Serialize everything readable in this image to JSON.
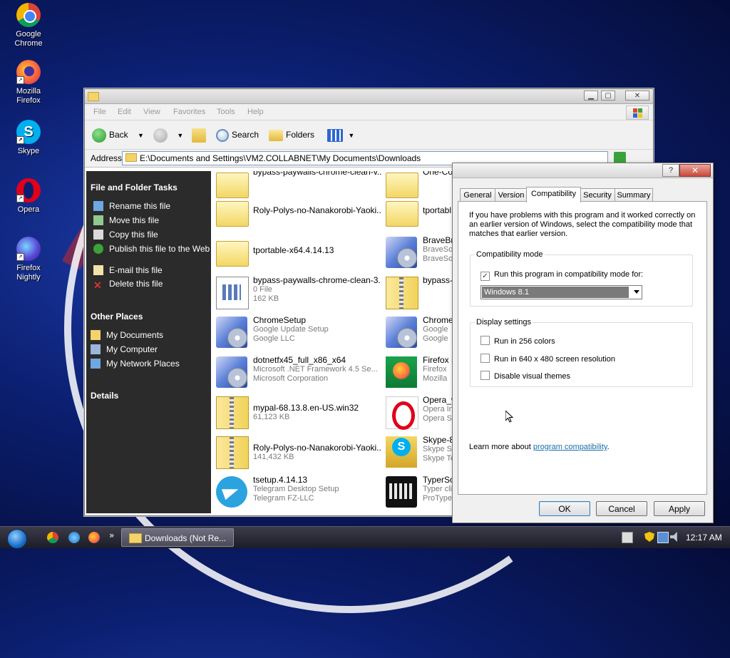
{
  "desktop": {
    "icons": [
      {
        "label": "Google Chrome",
        "icon": "chrome-icon"
      },
      {
        "label": "Mozilla Firefox",
        "icon": "firefox-icon"
      },
      {
        "label": "Skype",
        "icon": "skype-icon"
      },
      {
        "label": "Opera",
        "icon": "opera-icon"
      },
      {
        "label": "Firefox Nightly",
        "icon": "firefox-nightly-icon"
      }
    ]
  },
  "explorer": {
    "menu": [
      "File",
      "Edit",
      "View",
      "Favorites",
      "Tools",
      "Help"
    ],
    "toolbar": {
      "back": "Back",
      "search": "Search",
      "folders": "Folders"
    },
    "address_label": "Address",
    "address": "E:\\Documents and Settings\\VM2.COLLABNET\\My Documents\\Downloads",
    "tasks_title": "File and Folder Tasks",
    "tasks": [
      "Rename this file",
      "Move this file",
      "Copy this file",
      "Publish this file to the Web",
      "E-mail this file",
      "Delete this file"
    ],
    "other_title": "Other Places",
    "other": [
      "My Documents",
      "My Computer",
      "My Network Places"
    ],
    "details_title": "Details",
    "files_left": [
      {
        "name": "bypass-paywalls-chrome-clean-v...",
        "line2": "",
        "line3": "",
        "icon": "folder"
      },
      {
        "name": "Roly-Polys-no-Nanakorobi-Yaoki...",
        "line2": "",
        "line3": "",
        "icon": "folder"
      },
      {
        "name": "tportable-x64.4.14.13",
        "line2": "",
        "line3": "",
        "icon": "folder"
      },
      {
        "name": "bypass-paywalls-chrome-clean-3....",
        "line2": "0 File",
        "line3": "162 KB",
        "icon": "document"
      },
      {
        "name": "ChromeSetup",
        "line2": "Google Update Setup",
        "line3": "Google LLC",
        "icon": "setup"
      },
      {
        "name": "dotnetfx45_full_x86_x64",
        "line2": "Microsoft .NET Framework 4.5 Se...",
        "line3": "Microsoft Corporation",
        "icon": "dotnet"
      },
      {
        "name": "mypal-68.13.8.en-US.win32",
        "line2": "61,123 KB",
        "line3": "",
        "icon": "zip"
      },
      {
        "name": "Roly-Polys-no-Nanakorobi-Yaoki...",
        "line2": "141,432 KB",
        "line3": "",
        "icon": "zip"
      },
      {
        "name": "tsetup.4.14.13",
        "line2": "Telegram Desktop Setup",
        "line3": "Telegram FZ-LLC",
        "icon": "telegram"
      }
    ],
    "files_right": [
      {
        "name": "One-Co",
        "line2": "",
        "line3": "",
        "icon": "folder"
      },
      {
        "name": "tportabl",
        "line2": "",
        "line3": "",
        "icon": "folder"
      },
      {
        "name": "BraveBro",
        "line2": "BraveSo",
        "line3": "BraveSo",
        "icon": "setup"
      },
      {
        "name": "bypass-",
        "line2": "",
        "line3": "",
        "icon": "zip"
      },
      {
        "name": "Chrome",
        "line2": "Google",
        "line3": "Google",
        "icon": "setup"
      },
      {
        "name": "Firefox S",
        "line2": "Firefox",
        "line3": "Mozilla",
        "icon": "firefox-setup"
      },
      {
        "name": "Opera_w",
        "line2": "Opera In",
        "line3": "Opera S",
        "icon": "opera"
      },
      {
        "name": "Skype-8.",
        "line2": "Skype Se",
        "line3": "Skype Te",
        "icon": "skype-setup"
      },
      {
        "name": "TyperSol",
        "line2": "Typer cli",
        "line3": "ProTyper",
        "icon": "keyboard"
      }
    ]
  },
  "dialog": {
    "tabs": [
      "General",
      "Version",
      "Compatibility",
      "Security",
      "Summary"
    ],
    "active_tab": "Compatibility",
    "intro": "If you have problems with this program and it worked correctly on an earlier version of Windows, select the compatibility mode that matches that earlier version.",
    "compat_group": "Compatibility mode",
    "compat_check": "Run this program in compatibility mode for:",
    "compat_checked": true,
    "compat_select": "Windows 8.1",
    "display_group": "Display settings",
    "display_opts": [
      "Run in 256 colors",
      "Run in 640 x 480 screen resolution",
      "Disable visual themes"
    ],
    "learn_prefix": "Learn more about ",
    "learn_link": "program compatibility",
    "learn_suffix": ".",
    "buttons": {
      "ok": "OK",
      "cancel": "Cancel",
      "apply": "Apply"
    }
  },
  "taskbar": {
    "task": "Downloads (Not Re...",
    "clock": "12:17 AM",
    "overflow": "»"
  }
}
